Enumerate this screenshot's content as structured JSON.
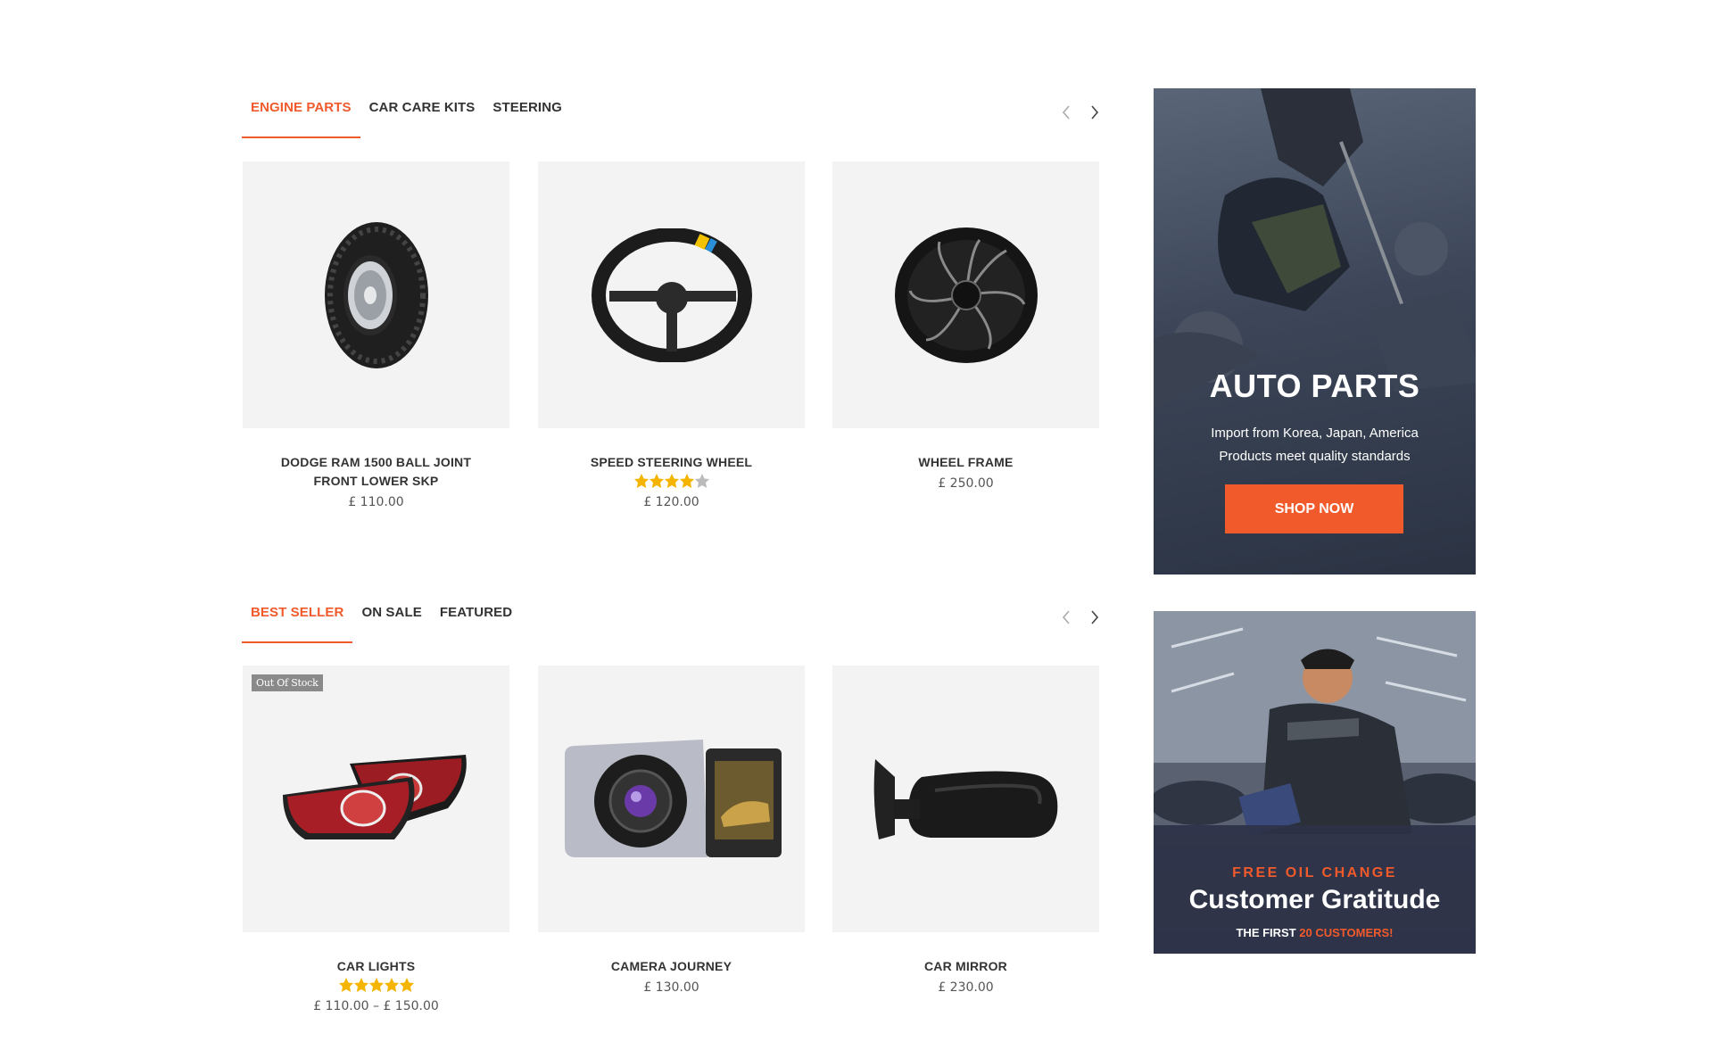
{
  "accent": "#f15a2b",
  "section1": {
    "tabs": [
      {
        "label": "ENGINE PARTS",
        "active": true
      },
      {
        "label": "CAR CARE KITS",
        "active": false
      },
      {
        "label": "STEERING",
        "active": false
      }
    ],
    "products": [
      {
        "name": "DODGE RAM 1500 BALL JOINT FRONT LOWER SKP",
        "price": "£ 110.00",
        "rating": null,
        "image": "tire-image"
      },
      {
        "name": "SPEED STEERING WHEEL",
        "price": "£ 120.00",
        "rating": 4,
        "image": "steering-wheel-image"
      },
      {
        "name": "WHEEL FRAME",
        "price": "£ 250.00",
        "rating": null,
        "image": "wheel-rim-image"
      }
    ]
  },
  "section2": {
    "tabs": [
      {
        "label": "BEST SELLER",
        "active": true
      },
      {
        "label": "ON SALE",
        "active": false
      },
      {
        "label": "FEATURED",
        "active": false
      }
    ],
    "products": [
      {
        "name": "CAR LIGHTS",
        "price": "£ 110.00 – £ 150.00",
        "rating": 5,
        "badge": "Out Of Stock",
        "image": "tail-lights-image"
      },
      {
        "name": "CAMERA JOURNEY",
        "price": "£ 130.00",
        "rating": null,
        "image": "dash-camera-image"
      },
      {
        "name": "CAR MIRROR",
        "price": "£ 230.00",
        "rating": null,
        "image": "side-mirror-image"
      }
    ]
  },
  "banner_auto": {
    "title": "AUTO PARTS",
    "line1": "Import from Korea, Japan, America",
    "line2": "Products meet quality standards",
    "button": "SHOP NOW"
  },
  "banner_oil": {
    "kicker": "FREE OIL CHANGE",
    "headline": "Customer Gratitude",
    "sub_prefix": "THE FIRST",
    "sub_accent": "20 CUSTOMERS!"
  }
}
